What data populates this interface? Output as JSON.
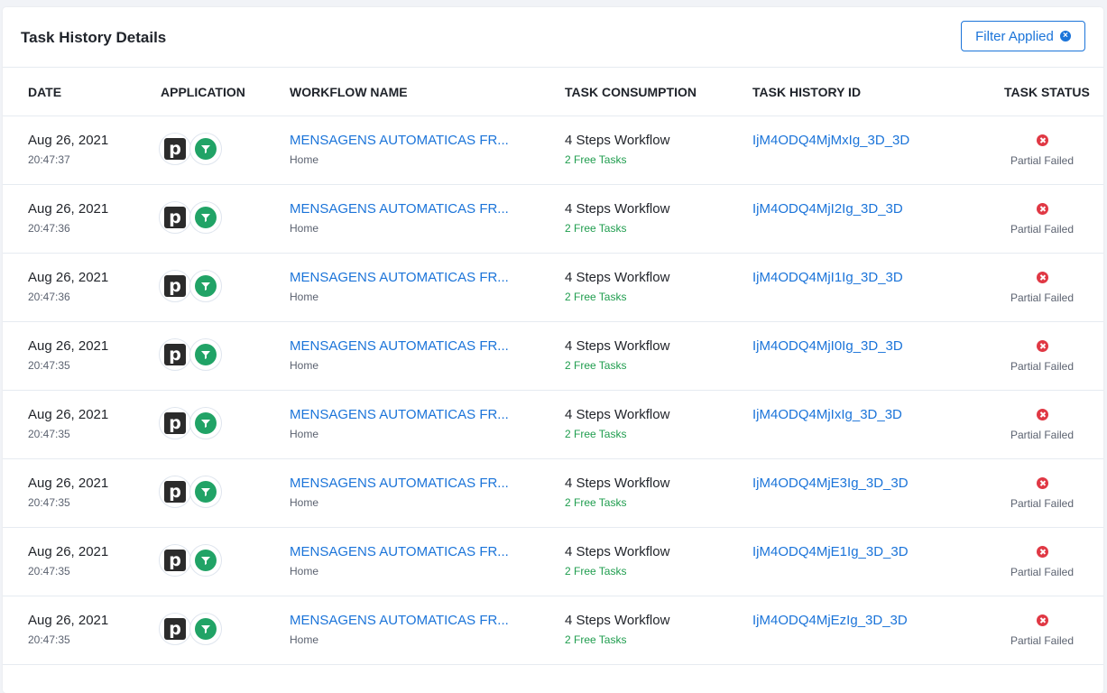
{
  "header": {
    "title": "Task History Details",
    "filter_label": "Filter Applied"
  },
  "columns": {
    "date": "DATE",
    "application": "APPLICATION",
    "workflow_name": "WORKFLOW NAME",
    "task_consumption": "TASK CONSUMPTION",
    "task_history_id": "TASK HISTORY ID",
    "task_status": "TASK STATUS"
  },
  "app_icons": [
    "pipedrive-icon",
    "filter-icon"
  ],
  "colors": {
    "accent": "#1b74d9",
    "success": "#1f9d4e",
    "error": "#e03844"
  },
  "rows": [
    {
      "date": "Aug 26, 2021",
      "time": "20:47:37",
      "workflow": "MENSAGENS AUTOMATICAS FR...",
      "folder": "Home",
      "steps": "4 Steps Workflow",
      "free": "2 Free Tasks",
      "id": "IjM4ODQ4MjMxIg_3D_3D",
      "status": "Partial Failed"
    },
    {
      "date": "Aug 26, 2021",
      "time": "20:47:36",
      "workflow": "MENSAGENS AUTOMATICAS FR...",
      "folder": "Home",
      "steps": "4 Steps Workflow",
      "free": "2 Free Tasks",
      "id": "IjM4ODQ4MjI2Ig_3D_3D",
      "status": "Partial Failed"
    },
    {
      "date": "Aug 26, 2021",
      "time": "20:47:36",
      "workflow": "MENSAGENS AUTOMATICAS FR...",
      "folder": "Home",
      "steps": "4 Steps Workflow",
      "free": "2 Free Tasks",
      "id": "IjM4ODQ4MjI1Ig_3D_3D",
      "status": "Partial Failed"
    },
    {
      "date": "Aug 26, 2021",
      "time": "20:47:35",
      "workflow": "MENSAGENS AUTOMATICAS FR...",
      "folder": "Home",
      "steps": "4 Steps Workflow",
      "free": "2 Free Tasks",
      "id": "IjM4ODQ4MjI0Ig_3D_3D",
      "status": "Partial Failed"
    },
    {
      "date": "Aug 26, 2021",
      "time": "20:47:35",
      "workflow": "MENSAGENS AUTOMATICAS FR...",
      "folder": "Home",
      "steps": "4 Steps Workflow",
      "free": "2 Free Tasks",
      "id": "IjM4ODQ4MjIxIg_3D_3D",
      "status": "Partial Failed"
    },
    {
      "date": "Aug 26, 2021",
      "time": "20:47:35",
      "workflow": "MENSAGENS AUTOMATICAS FR...",
      "folder": "Home",
      "steps": "4 Steps Workflow",
      "free": "2 Free Tasks",
      "id": "IjM4ODQ4MjE3Ig_3D_3D",
      "status": "Partial Failed"
    },
    {
      "date": "Aug 26, 2021",
      "time": "20:47:35",
      "workflow": "MENSAGENS AUTOMATICAS FR...",
      "folder": "Home",
      "steps": "4 Steps Workflow",
      "free": "2 Free Tasks",
      "id": "IjM4ODQ4MjE1Ig_3D_3D",
      "status": "Partial Failed"
    },
    {
      "date": "Aug 26, 2021",
      "time": "20:47:35",
      "workflow": "MENSAGENS AUTOMATICAS FR...",
      "folder": "Home",
      "steps": "4 Steps Workflow",
      "free": "2 Free Tasks",
      "id": "IjM4ODQ4MjEzIg_3D_3D",
      "status": "Partial Failed"
    }
  ]
}
